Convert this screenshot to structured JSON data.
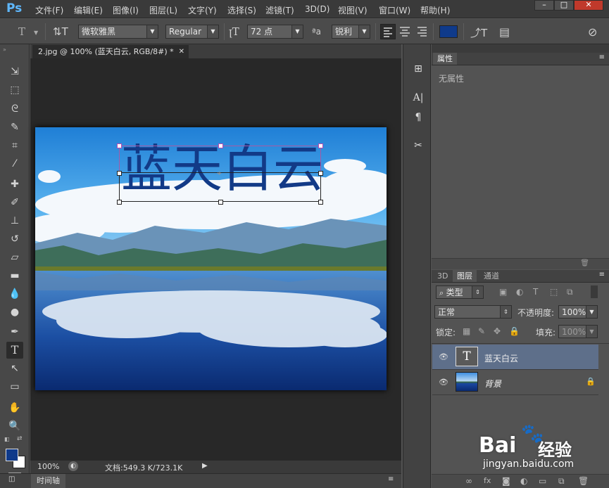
{
  "app": {
    "logo": "Ps"
  },
  "menu": [
    "文件(F)",
    "编辑(E)",
    "图像(I)",
    "图层(L)",
    "文字(Y)",
    "选择(S)",
    "滤镜(T)",
    "3D(D)",
    "视图(V)",
    "窗口(W)",
    "帮助(H)"
  ],
  "window_controls": {
    "minimize": "–",
    "maximize": "□",
    "close": "✕"
  },
  "options": {
    "font_family": "微软雅黑",
    "font_style": "Regular",
    "font_size": "72 点",
    "aa_label": "ªa",
    "antialias": "锐利",
    "text_color": "#0f3a8a"
  },
  "document": {
    "tab_title": "2.jpg @ 100% (蓝天白云, RGB/8#) *",
    "text_content": "蓝天白云",
    "text_color": "#123a87"
  },
  "status": {
    "zoom": "100%",
    "doc_info": "文档:549.3 K/723.1K"
  },
  "timeline": {
    "label": "时间轴"
  },
  "properties_panel": {
    "tab": "属性",
    "empty_text": "无属性"
  },
  "layers_panel": {
    "tabs": [
      "3D",
      "图层",
      "通道"
    ],
    "filter_kind": "类型",
    "blend_mode": "正常",
    "opacity_label": "不透明度:",
    "opacity": "100%",
    "lock_label": "锁定:",
    "fill_label": "填充:",
    "fill": "100%",
    "layers": [
      {
        "name": "蓝天白云",
        "type": "text",
        "selected": true
      },
      {
        "name": "背景",
        "type": "image",
        "selected": false,
        "locked": true
      }
    ]
  },
  "watermark": {
    "brand": "Bai",
    "brand_cn": "经验",
    "url": "jingyan.baidu.com"
  }
}
